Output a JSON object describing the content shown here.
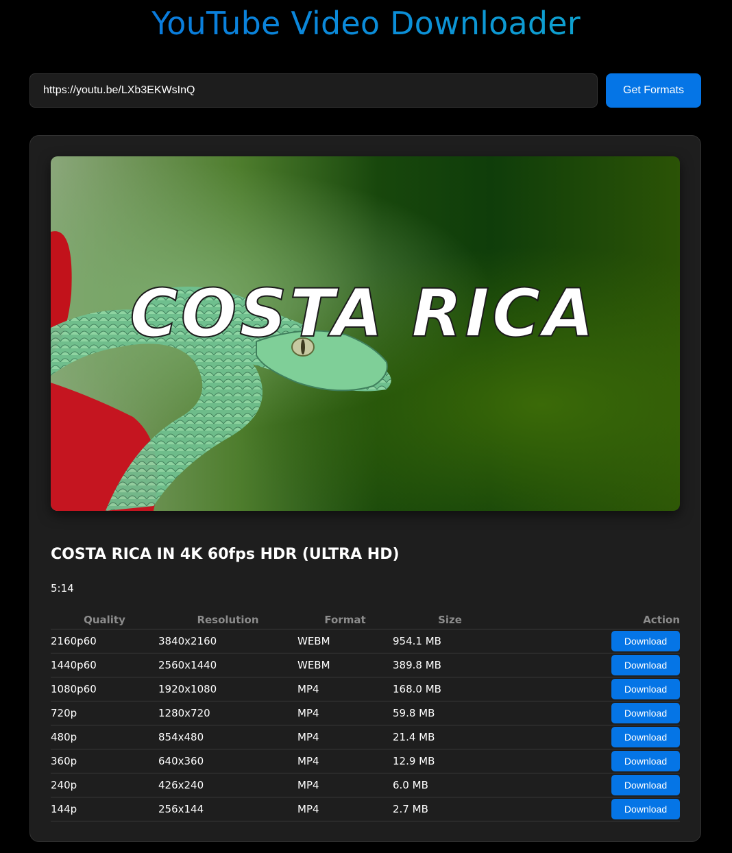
{
  "app": {
    "title": "YouTube Video Downloader"
  },
  "search": {
    "value": "https://youtu.be/LXb3EKWsInQ",
    "button_label": "Get Formats"
  },
  "video": {
    "thumbnail_text": "COSTA RICA",
    "title": "COSTA RICA IN 4K 60fps HDR (ULTRA HD)",
    "duration": "5:14"
  },
  "table": {
    "headers": {
      "quality": "Quality",
      "resolution": "Resolution",
      "format": "Format",
      "size": "Size",
      "action": "Action"
    },
    "rows": [
      {
        "quality": "2160p60",
        "resolution": "3840x2160",
        "format": "WEBM",
        "size": "954.1 MB",
        "action": "Download"
      },
      {
        "quality": "1440p60",
        "resolution": "2560x1440",
        "format": "WEBM",
        "size": "389.8 MB",
        "action": "Download"
      },
      {
        "quality": "1080p60",
        "resolution": "1920x1080",
        "format": "MP4",
        "size": "168.0 MB",
        "action": "Download"
      },
      {
        "quality": "720p",
        "resolution": "1280x720",
        "format": "MP4",
        "size": "59.8 MB",
        "action": "Download"
      },
      {
        "quality": "480p",
        "resolution": "854x480",
        "format": "MP4",
        "size": "21.4 MB",
        "action": "Download"
      },
      {
        "quality": "360p",
        "resolution": "640x360",
        "format": "MP4",
        "size": "12.9 MB",
        "action": "Download"
      },
      {
        "quality": "240p",
        "resolution": "426x240",
        "format": "MP4",
        "size": "6.0 MB",
        "action": "Download"
      },
      {
        "quality": "144p",
        "resolution": "256x144",
        "format": "MP4",
        "size": "2.7 MB",
        "action": "Download"
      }
    ]
  },
  "colors": {
    "accent": "#0575e6",
    "background": "#000000",
    "card": "#1e1e1e"
  }
}
